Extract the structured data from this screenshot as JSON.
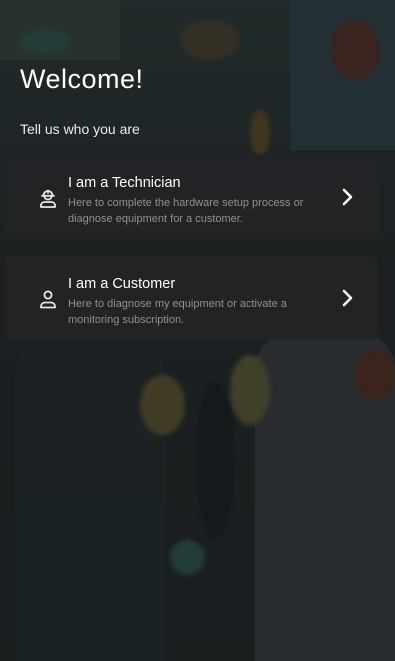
{
  "header": {
    "title": "Welcome!",
    "subtitle": "Tell us who you are"
  },
  "options": [
    {
      "id": "technician",
      "icon": "technician-icon",
      "title": "I am a Technician",
      "description": "Here to complete the hardware setup process or diagnose equipment for a customer.",
      "action_icon": "chevron-right-icon"
    },
    {
      "id": "customer",
      "icon": "person-icon",
      "title": "I am a Customer",
      "description": "Here to diagnose my equipment or activate a monitoring subscription.",
      "action_icon": "chevron-right-icon"
    }
  ],
  "colors": {
    "card_background": "#222426",
    "text_primary": "#ffffff",
    "text_secondary": "#8d9295"
  }
}
